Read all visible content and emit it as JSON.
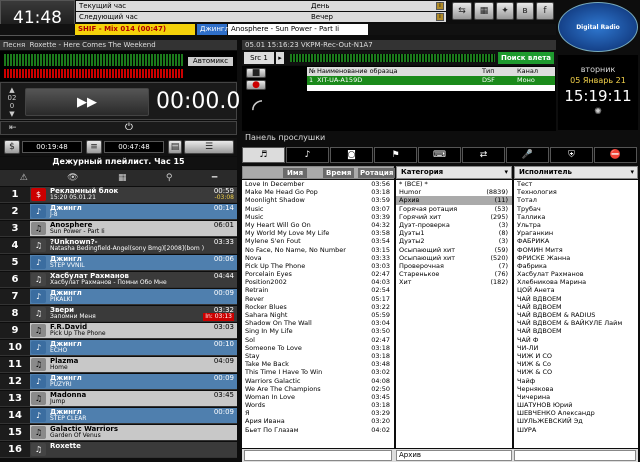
{
  "clock": "41:48",
  "now": [
    {
      "label": "Текущий час",
      "value": "День"
    },
    {
      "label": "Следующий час",
      "value": "Вечер"
    }
  ],
  "logo": "Digital Radio",
  "date": {
    "day": "вторник",
    "date": "05 Январь 21",
    "time": "15:19:11"
  },
  "shif": {
    "a": "SHIF - Mix 014 (00:47)",
    "b": "Джингл",
    "c": "Anosphere - Sun Power - Part Ii"
  },
  "player": {
    "song_label": "Песня",
    "song": "Roxette - Here Comes The Weekend",
    "automix": "Автомикс",
    "time": "00:00.0",
    "count_a": "02",
    "count_b": "0"
  },
  "stamp": {
    "a": "00:19:48",
    "b": "00:47:48"
  },
  "playlist_title": "Дежурный плейлист. Час 15",
  "rows": [
    {
      "n": "1",
      "type": "ad",
      "t1": "Рекламный блок",
      "t2": "15:20 05.01.21",
      "tm1": "00:59",
      "tm2": "-03:08"
    },
    {
      "n": "2",
      "type": "jingle",
      "t1": "Джингл",
      "t2": "J-8",
      "tm1": "00:14",
      "tm2": ""
    },
    {
      "n": "3",
      "type": "song",
      "t1": "Anosphere",
      "t2": "Sun Power - Part Ii",
      "tm1": "06:01",
      "tm2": ""
    },
    {
      "n": "4",
      "type": "song",
      "t1": "?Unknown?-",
      "t2": "Natasha Bedingfield-Angel(sony Bmg)[2008](bom )",
      "tm1": "03:33",
      "tm2": ""
    },
    {
      "n": "5",
      "type": "jingle",
      "t1": "Джингл",
      "t2": "STEP VVNIL",
      "tm1": "00:06",
      "tm2": ""
    },
    {
      "n": "6",
      "type": "song",
      "t1": "Хасбулат Рахманов",
      "t2": "Хасбулат Рахманов - Помни Обо Мне",
      "tm1": "04:44",
      "tm2": ""
    },
    {
      "n": "7",
      "type": "jingle",
      "t1": "Джингл",
      "t2": "PIKALKI",
      "tm1": "00:09",
      "tm2": ""
    },
    {
      "n": "8",
      "type": "song",
      "t1": "Звери",
      "t2": "Запомни Меня",
      "tm1": "03:32",
      "tm2": "In: 03:13"
    },
    {
      "n": "9",
      "type": "song",
      "t1": "F.R.David",
      "t2": "Pick Up The Phone",
      "tm1": "03:03",
      "tm2": ""
    },
    {
      "n": "10",
      "type": "jingle",
      "t1": "Джингл",
      "t2": "ECHO",
      "tm1": "00:10",
      "tm2": ""
    },
    {
      "n": "11",
      "type": "song",
      "t1": "Plazma",
      "t2": "Home",
      "tm1": "04:09",
      "tm2": ""
    },
    {
      "n": "12",
      "type": "jingle",
      "t1": "Джингл",
      "t2": "PUZYRI",
      "tm1": "00:09",
      "tm2": ""
    },
    {
      "n": "13",
      "type": "song",
      "t1": "Madonna",
      "t2": "Jump",
      "tm1": "03:45",
      "tm2": ""
    },
    {
      "n": "14",
      "type": "jingle",
      "t1": "Джингл",
      "t2": "STEP CLEAR",
      "tm1": "00:09",
      "tm2": ""
    },
    {
      "n": "15",
      "type": "song",
      "t1": "Galactic Warriors",
      "t2": "Garden Of Venus",
      "tm1": "",
      "tm2": ""
    },
    {
      "n": "16",
      "type": "song",
      "t1": "Roxette",
      "t2": "",
      "tm1": "",
      "tm2": ""
    }
  ],
  "record": {
    "header": "05.01 15:16:23 VKPM-Rec-Out-N1A7",
    "src": "Src 1",
    "search": "Поиск влета",
    "cols": [
      "№",
      "Наименование образца",
      "Тип",
      "Канал"
    ],
    "row": [
      "1",
      "XIT-UA-A159D",
      "DSF",
      "Моно"
    ]
  },
  "panel_title": "Панель прослушки",
  "sort": {
    "name": "Имя",
    "time": "Время",
    "rot": "Ротация"
  },
  "songs": [
    [
      "Love In December",
      "03:56"
    ],
    [
      "Make Me Head Go Pop",
      "03:18"
    ],
    [
      "Moonlight Shadow",
      "03:59"
    ],
    [
      "Music",
      "03:07"
    ],
    [
      "Music",
      "03:39"
    ],
    [
      "My Heart Will Go On",
      "04:32"
    ],
    [
      "My World My Love My Life",
      "03:58"
    ],
    [
      "Mylene S'en Fout",
      "03:54"
    ],
    [
      "No Face, No Name, No Number",
      "03:15"
    ],
    [
      "Nova",
      "03:33"
    ],
    [
      "Pick Up The Phone",
      "03:03"
    ],
    [
      "Porcelain Eyes",
      "02:47"
    ],
    [
      "Position2002",
      "04:03"
    ],
    [
      "Retrain",
      "02:54"
    ],
    [
      "Rever",
      "05:17"
    ],
    [
      "Rocker Blues",
      "03:22"
    ],
    [
      "Sahara Night",
      "05:59"
    ],
    [
      "Shadow On The Wall",
      "03:04"
    ],
    [
      "Sing In My Life",
      "03:50"
    ],
    [
      "Sol",
      "02:47"
    ],
    [
      "Someone To Love",
      "03:18"
    ],
    [
      "Stay",
      "03:18"
    ],
    [
      "Take Me Back",
      "03:48"
    ],
    [
      "This Time I Have To Win",
      "03:02"
    ],
    [
      "Warriors Galactic",
      "04:08"
    ],
    [
      "We Are The Champions",
      "02:50"
    ],
    [
      "Woman In Love",
      "03:45"
    ],
    [
      "Words",
      "03:18"
    ],
    [
      "Я",
      "03:29"
    ],
    [
      "Ария Ивана",
      "03:20"
    ],
    [
      "Бьет По Глазам",
      "04:02"
    ]
  ],
  "cat_header": "Категория",
  "cats": [
    [
      "* (ВСЕ) *",
      ""
    ],
    [
      "Humor",
      "(8839)"
    ],
    [
      "Архив",
      "(11)"
    ],
    [
      "Горячая ротация",
      "(53)"
    ],
    [
      "Горячий хит",
      "(295)"
    ],
    [
      "Дуэт-проверка",
      "(3)"
    ],
    [
      "Дуэты1",
      "(8)"
    ],
    [
      "Дуэты2",
      "(3)"
    ],
    [
      "Осыпающий хит",
      "(59)"
    ],
    [
      "Осыпающий хит",
      "(520)"
    ],
    [
      "Проверочная",
      "(7)"
    ],
    [
      "Старенькое",
      "(76)"
    ],
    [
      "Хит",
      "(182)"
    ]
  ],
  "art_header": "Исполнитель",
  "artists": [
    "Тест",
    "Технология",
    "Тотал",
    "Трубач",
    "Таллика",
    "Ультра",
    "Ураганкин",
    "ФАБРИКА",
    "ФОМИН Митя",
    "ФРИСКЕ Жанна",
    "Фабрика",
    "Хасбулат Рахманов",
    "Хлебникова Марина",
    "ЦОЙ Анета",
    "ЧАЙ ВДВОЕМ",
    "ЧАЙ ВДВОЕМ",
    "ЧАЙ ВДВОЕМ & RADIUS",
    "ЧАЙ ВДВОЕМ & ВАЙКУЛЕ Лайм",
    "ЧАЙ ВДВОЕМ",
    "ЧАЙ Ф",
    "ЧИ-ЛИ",
    "ЧИЖ И СО",
    "ЧИЖ & Co",
    "ЧИЖ & CO",
    "Чайф",
    "Чернякова",
    "Чичерина",
    "ШАТУНОВ Юрий",
    "ШЕВЧЕНКО Александр",
    "ШУЛЬЖЕВСКИЙ Эд",
    "ШУРА"
  ],
  "bottom": {
    "cat": "Архив"
  }
}
